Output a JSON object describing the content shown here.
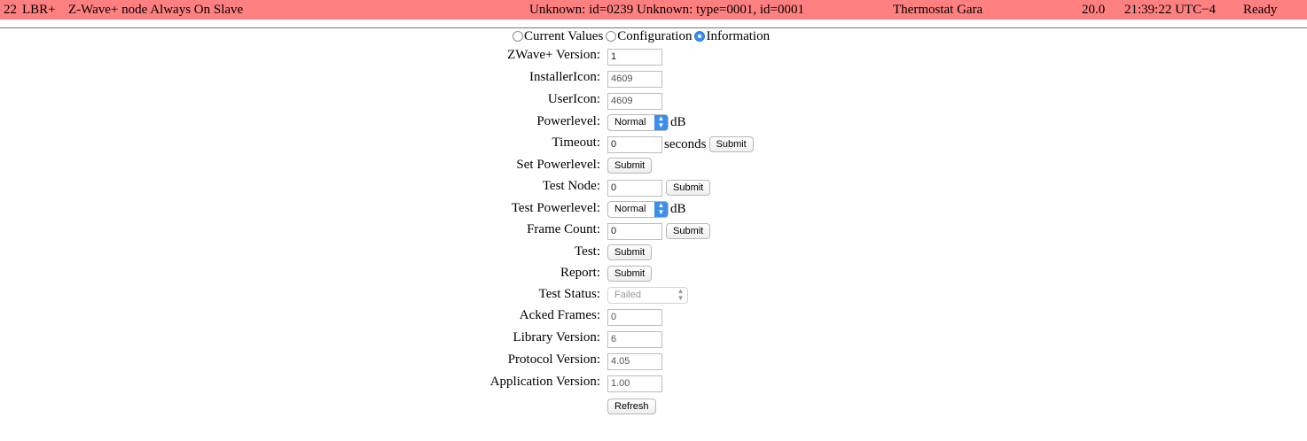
{
  "node": {
    "id": "22",
    "lib": "LBR+",
    "type": "Z-Wave+ node Always On Slave",
    "product": "Unknown: id=0239 Unknown: type=0001, id=0001",
    "name": "Thermostat Gara",
    "value": "20.0",
    "time": "21:39:22 UTC−4",
    "status": "Ready"
  },
  "tabs": [
    {
      "label": "Current Values",
      "selected": false
    },
    {
      "label": "Configuration",
      "selected": false
    },
    {
      "label": "Information",
      "selected": true
    }
  ],
  "info": {
    "zwave_version": {
      "label": "ZWave+ Version:",
      "value": "1"
    },
    "installer_icon": {
      "label": "InstallerIcon:",
      "value": "4609"
    },
    "user_icon": {
      "label": "UserIcon:",
      "value": "4609"
    },
    "powerlevel": {
      "label": "Powerlevel:",
      "selected": "Normal",
      "unit": "dB"
    },
    "timeout": {
      "label": "Timeout:",
      "value": "0",
      "unit": "seconds",
      "button": "Submit"
    },
    "set_powerlevel": {
      "label": "Set Powerlevel:",
      "button": "Submit"
    },
    "test_node": {
      "label": "Test Node:",
      "value": "0",
      "button": "Submit"
    },
    "test_powerlevel": {
      "label": "Test Powerlevel:",
      "selected": "Normal",
      "unit": "dB"
    },
    "frame_count": {
      "label": "Frame Count:",
      "value": "0",
      "button": "Submit"
    },
    "test": {
      "label": "Test:",
      "button": "Submit"
    },
    "report": {
      "label": "Report:",
      "button": "Submit"
    },
    "test_status": {
      "label": "Test Status:",
      "selected": "Failed"
    },
    "acked_frames": {
      "label": "Acked Frames:",
      "value": "0"
    },
    "library_version": {
      "label": "Library Version:",
      "value": "6"
    },
    "protocol_version": {
      "label": "Protocol Version:",
      "value": "4.05"
    },
    "application_version": {
      "label": "Application Version:",
      "value": "1.00"
    },
    "refresh_button": "Refresh"
  },
  "colors": {
    "node_bar": "#ff8080",
    "accent": "#3b8eea"
  }
}
